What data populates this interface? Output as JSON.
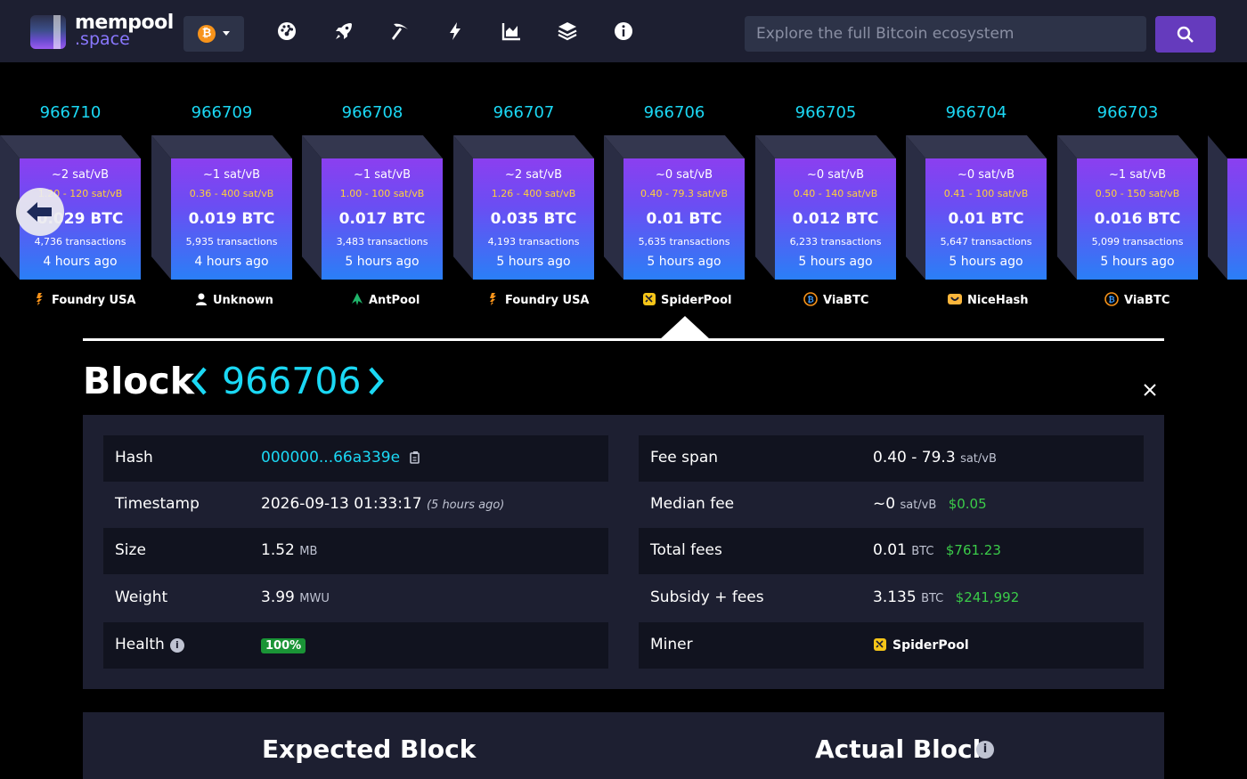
{
  "header": {
    "logo_line1": "mempool",
    "logo_line2": ".space",
    "network_symbol": "₿",
    "search_placeholder": "Explore the full Bitcoin ecosystem",
    "nav_icons": [
      "dashboard-icon",
      "rocket-icon",
      "pickaxe-icon",
      "lightning-icon",
      "chart-icon",
      "layers-icon",
      "info-icon"
    ]
  },
  "blocks": [
    {
      "height": "966710",
      "median": "~2 sat/vB",
      "range": "1.20 - 120 sat/vB",
      "size": "0.029 BTC",
      "txs": "4,736 transactions",
      "ago": "4 hours ago",
      "pool": "Foundry USA"
    },
    {
      "height": "966709",
      "median": "~1 sat/vB",
      "range": "0.36 - 400 sat/vB",
      "size": "0.019 BTC",
      "txs": "5,935 transactions",
      "ago": "4 hours ago",
      "pool": "Unknown"
    },
    {
      "height": "966708",
      "median": "~1 sat/vB",
      "range": "1.00 - 100 sat/vB",
      "size": "0.017 BTC",
      "txs": "3,483 transactions",
      "ago": "5 hours ago",
      "pool": "AntPool"
    },
    {
      "height": "966707",
      "median": "~2 sat/vB",
      "range": "1.26 - 400 sat/vB",
      "size": "0.035 BTC",
      "txs": "4,193 transactions",
      "ago": "5 hours ago",
      "pool": "Foundry USA"
    },
    {
      "height": "966706",
      "median": "~0 sat/vB",
      "range": "0.40 - 79.3 sat/vB",
      "size": "0.01 BTC",
      "txs": "5,635 transactions",
      "ago": "5 hours ago",
      "pool": "SpiderPool"
    },
    {
      "height": "966705",
      "median": "~0 sat/vB",
      "range": "0.40 - 140 sat/vB",
      "size": "0.012 BTC",
      "txs": "6,233 transactions",
      "ago": "5 hours ago",
      "pool": "ViaBTC"
    },
    {
      "height": "966704",
      "median": "~0 sat/vB",
      "range": "0.41 - 100 sat/vB",
      "size": "0.01 BTC",
      "txs": "5,647 transactions",
      "ago": "5 hours ago",
      "pool": "NiceHash"
    },
    {
      "height": "966703",
      "median": "~1 sat/vB",
      "range": "0.50 - 150 sat/vB",
      "size": "0.016 BTC",
      "txs": "5,099 transactions",
      "ago": "5 hours ago",
      "pool": "ViaBTC"
    }
  ],
  "block_title": {
    "word": "Block",
    "height": "966706"
  },
  "details": {
    "hash_label": "Hash",
    "hash_value": "000000...66a339e",
    "timestamp_label": "Timestamp",
    "timestamp_value": "2026-09-13 01:33:17",
    "timestamp_relative": "(5 hours ago)",
    "size_label": "Size",
    "size_value": "1.52",
    "size_unit": "MB",
    "weight_label": "Weight",
    "weight_value": "3.99",
    "weight_unit": "MWU",
    "health_label": "Health",
    "health_value": "100%",
    "feespan_label": "Fee span",
    "feespan_value": "0.40 - 79.3",
    "feespan_unit": "sat/vB",
    "median_label": "Median fee",
    "median_value": "~0",
    "median_unit": "sat/vB",
    "median_usd": "$0.05",
    "totalfees_label": "Total fees",
    "totalfees_value": "0.01",
    "totalfees_unit": "BTC",
    "totalfees_usd": "$761.23",
    "subsidy_label": "Subsidy + fees",
    "subsidy_value": "3.135",
    "subsidy_unit": "BTC",
    "subsidy_usd": "$241,992",
    "miner_label": "Miner",
    "miner_value": "SpiderPool"
  },
  "comparison": {
    "expected_title": "Expected Block",
    "actual_title": "Actual Block"
  },
  "colors": {
    "accent": "#1bd8f4",
    "usd_green": "#3bcc49",
    "fee_yellow": "#ffd23a",
    "header_bg": "#1d1f31",
    "search_btn": "#653bbd"
  }
}
